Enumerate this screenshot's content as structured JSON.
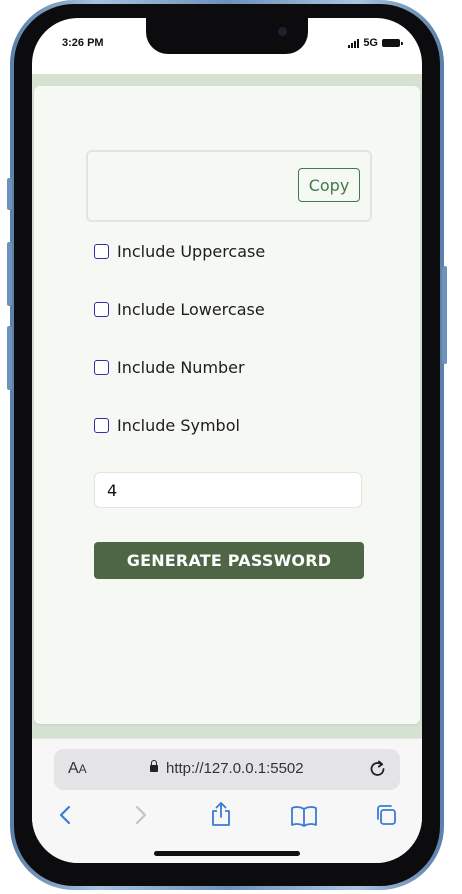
{
  "status_bar": {
    "time": "3:26 PM",
    "network": "5G",
    "icons": [
      "signal-icon",
      "battery-icon"
    ]
  },
  "app": {
    "password_output": "",
    "copy_label": "Copy",
    "options": [
      {
        "label": "Include Uppercase",
        "checked": false
      },
      {
        "label": "Include Lowercase",
        "checked": false
      },
      {
        "label": "Include Number",
        "checked": false
      },
      {
        "label": "Include Symbol",
        "checked": false
      }
    ],
    "length_value": "4",
    "generate_label": "GENERATE PASSWORD"
  },
  "browser": {
    "text_size_label_big": "A",
    "text_size_label_small": "A",
    "url": "http://127.0.0.1:5502",
    "icons": [
      "lock-icon",
      "reload-icon",
      "back-icon",
      "forward-icon",
      "share-icon",
      "bookmarks-icon",
      "tabs-icon"
    ]
  },
  "colors": {
    "accent": "#4e6645",
    "copy_text": "#417a4a",
    "checkbox_border": "#2b2fb0",
    "page_background": "#d5e2d2",
    "card_background": "#f6f8f4",
    "browser_tint": "#3a7bd5"
  }
}
